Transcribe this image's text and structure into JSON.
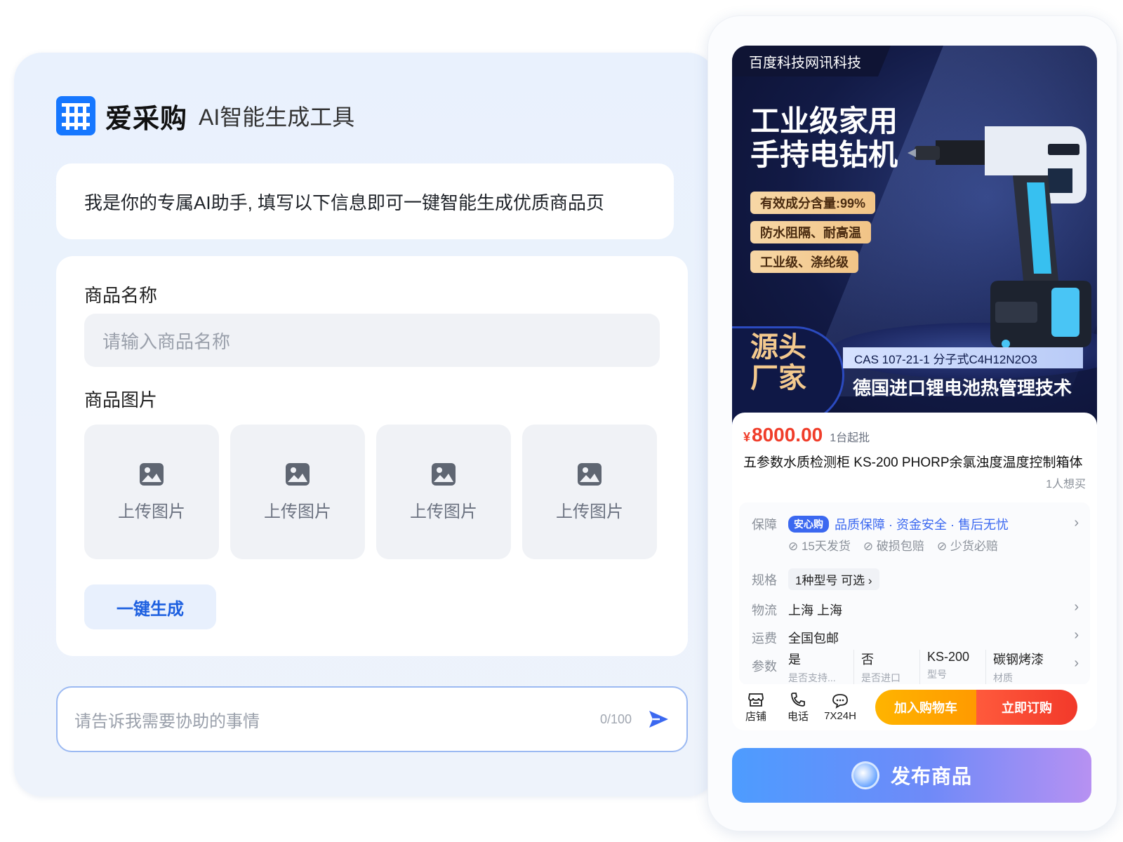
{
  "brand": {
    "name": "爱采购",
    "subtitle": "AI智能生成工具",
    "logo_icon": "cai-logo-icon",
    "accent": "#1677ff"
  },
  "greeting": "我是你的专属AI助手, 填写以下信息即可一键智能生成优质商品页",
  "form": {
    "name_label": "商品名称",
    "name_placeholder": "请输入商品名称",
    "image_label": "商品图片",
    "uploads": [
      {
        "label": "上传图片",
        "icon": "image-icon"
      },
      {
        "label": "上传图片",
        "icon": "image-icon"
      },
      {
        "label": "上传图片",
        "icon": "image-icon"
      },
      {
        "label": "上传图片",
        "icon": "image-icon"
      }
    ],
    "generate_label": "一键生成"
  },
  "chat": {
    "placeholder": "请告诉我需要协助的事情",
    "counter": "0/100",
    "send_icon": "send-icon"
  },
  "preview": {
    "banner": {
      "company": "百度科技网讯科技",
      "title_line1": "工业级家用",
      "title_line2": "手持电钻机",
      "pills": [
        "有效成分含量:99%",
        "防水阻隔、耐高温",
        "工业级、涤纶级"
      ],
      "source_line1": "源头",
      "source_line2": "厂家",
      "cas": "CAS 107-21-1 分子式C4H12N2O3",
      "tech": "德国进口锂电池热管理技术"
    },
    "price_symbol": "¥",
    "price": "8000.00",
    "moq": "1台起批",
    "product_name": "五参数水质检测柜 KS-200 PHORP余氯浊度温度控制箱体",
    "wants": "1人想买",
    "guarantee": {
      "label": "保障",
      "badge": "安心购",
      "text": "品质保障 · 资金安全 · 售后无忧",
      "checks": [
        "15天发货",
        "破损包赔",
        "少货必赔"
      ]
    },
    "spec": {
      "label": "规格",
      "value": "1种型号 可选"
    },
    "logistics": {
      "label": "物流",
      "value": "上海 上海"
    },
    "shipping": {
      "label": "运费",
      "value": "全国包邮"
    },
    "params": {
      "label": "参数",
      "items": [
        {
          "v": "是",
          "k": "是否支持..."
        },
        {
          "v": "否",
          "k": "是否进口"
        },
        {
          "v": "KS-200",
          "k": "型号"
        },
        {
          "v": "碳钢烤漆",
          "k": "材质"
        }
      ]
    },
    "actions": [
      {
        "label": "店铺",
        "icon": "store-icon"
      },
      {
        "label": "电话",
        "icon": "phone-icon"
      },
      {
        "label": "7X24H",
        "icon": "chat-bubble-icon"
      }
    ],
    "cart_label": "加入购物车",
    "buy_label": "立即订购",
    "publish_label": "发布商品"
  }
}
